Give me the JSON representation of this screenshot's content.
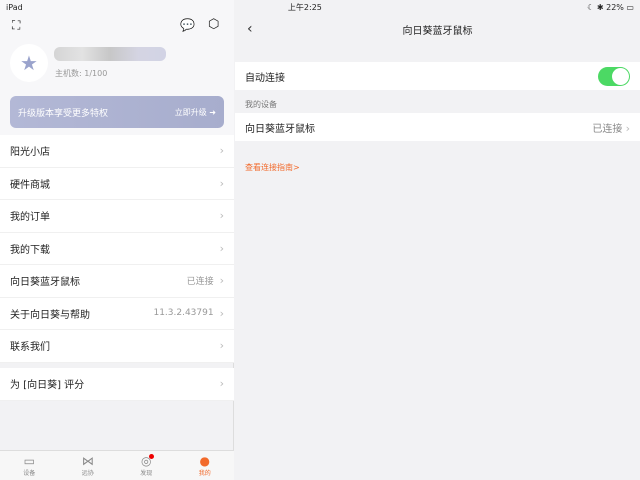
{
  "status": {
    "device": "iPad",
    "time": "上午2:25",
    "battery": "22%"
  },
  "left": {
    "host_count": "主机数: 1/100",
    "banner_text": "升级版本享受更多特权",
    "banner_action": "立即升级",
    "menu": [
      {
        "label": "阳光小店",
        "value": ""
      },
      {
        "label": "硬件商城",
        "value": ""
      },
      {
        "label": "我的订单",
        "value": ""
      },
      {
        "label": "我的下载",
        "value": ""
      },
      {
        "label": "向日葵蓝牙鼠标",
        "value": "已连接"
      },
      {
        "label": "关于向日葵与帮助",
        "value": "11.3.2.43791"
      },
      {
        "label": "联系我们",
        "value": ""
      }
    ],
    "rate": "为 [向日葵] 评分",
    "tabs": [
      {
        "label": "设备",
        "icon": "monitor-icon"
      },
      {
        "label": "远协",
        "icon": "remote-assist-icon"
      },
      {
        "label": "发现",
        "icon": "compass-icon"
      },
      {
        "label": "我的",
        "icon": "profile-icon"
      }
    ]
  },
  "right": {
    "title": "向日葵蓝牙鼠标",
    "auto_connect": "自动连接",
    "auto_connect_on": true,
    "section": "我的设备",
    "device": "向日葵蓝牙鼠标",
    "device_status": "已连接",
    "guide": "查看连接指南>"
  },
  "colors": {
    "accent": "#f26a2b",
    "toggle": "#4cd964"
  }
}
